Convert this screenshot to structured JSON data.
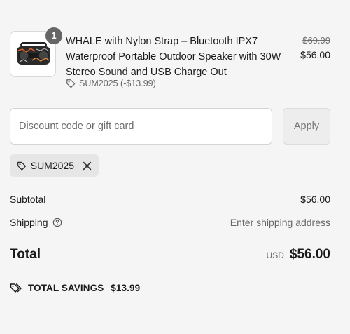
{
  "line_item": {
    "quantity": "1",
    "title": "WHALE with Nylon Strap – Bluetooth IPX7 Waterproof Portable Outdoor Speaker with 30W Stereo Sound and USB Charge Out",
    "compare_price": "$69.99",
    "price": "$56.00",
    "discount_text": "SUM2025 (-$13.99)",
    "thumbnail_icon": "speaker-icon"
  },
  "discount_form": {
    "placeholder": "Discount code or gift card",
    "value": "",
    "apply_label": "Apply"
  },
  "applied_code": {
    "code": "SUM2025",
    "tag_icon": "tag-icon",
    "remove_icon": "close-icon"
  },
  "summary": {
    "subtotal_label": "Subtotal",
    "subtotal_value": "$56.00",
    "shipping_label": "Shipping",
    "shipping_help_icon": "help-circle-icon",
    "shipping_value": "Enter shipping address",
    "total_label": "Total",
    "currency": "USD",
    "total_value": "$56.00"
  },
  "savings": {
    "label": "TOTAL SAVINGS",
    "amount": "$13.99",
    "icon": "tags-icon"
  },
  "colors": {
    "background": "#f5f5f5",
    "badge": "#666666",
    "muted_text": "#666666",
    "chip_bg": "#e6e6e6"
  }
}
